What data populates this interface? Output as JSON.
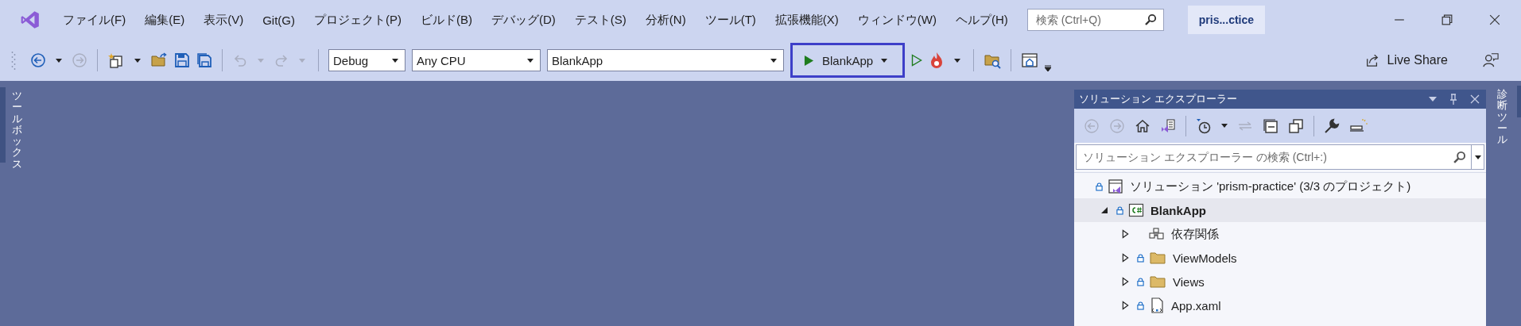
{
  "menu_bar": {
    "items": [
      "ファイル(F)",
      "編集(E)",
      "表示(V)",
      "Git(G)",
      "プロジェクト(P)",
      "ビルド(B)",
      "デバッグ(D)",
      "テスト(S)",
      "分析(N)",
      "ツール(T)",
      "拡張機能(X)",
      "ウィンドウ(W)",
      "ヘルプ(H)"
    ],
    "search": {
      "placeholder": "検索 (Ctrl+Q)"
    },
    "solution_name": "pris...ctice"
  },
  "toolbar": {
    "configuration": "Debug",
    "platform": "Any CPU",
    "startup_project": "BlankApp",
    "run_button": {
      "label": "BlankApp",
      "highlighted": true
    },
    "live_share": "Live Share"
  },
  "side_tabs": {
    "left": "ツールボックス",
    "right": "診断ツール"
  },
  "solution_explorer": {
    "title": "ソリューション エクスプローラー",
    "search": {
      "placeholder": "ソリューション エクスプローラー の検索 (Ctrl+:)"
    },
    "tree": [
      {
        "label": "ソリューション 'prism-practice' (3/3 のプロジェクト)",
        "kind": "solution",
        "locked": true,
        "selected": false,
        "children": [
          {
            "label": "BlankApp",
            "kind": "project",
            "locked": true,
            "selected": true,
            "expanded": true,
            "children": [
              {
                "label": "依存関係",
                "kind": "dependencies",
                "locked": false,
                "selected": false,
                "expanded": false
              },
              {
                "label": "ViewModels",
                "kind": "folder",
                "locked": true,
                "selected": false,
                "expanded": false
              },
              {
                "label": "Views",
                "kind": "folder",
                "locked": true,
                "selected": false,
                "expanded": false
              },
              {
                "label": "App.xaml",
                "kind": "xaml",
                "locked": true,
                "selected": false,
                "expanded": false
              }
            ]
          }
        ]
      }
    ]
  }
}
